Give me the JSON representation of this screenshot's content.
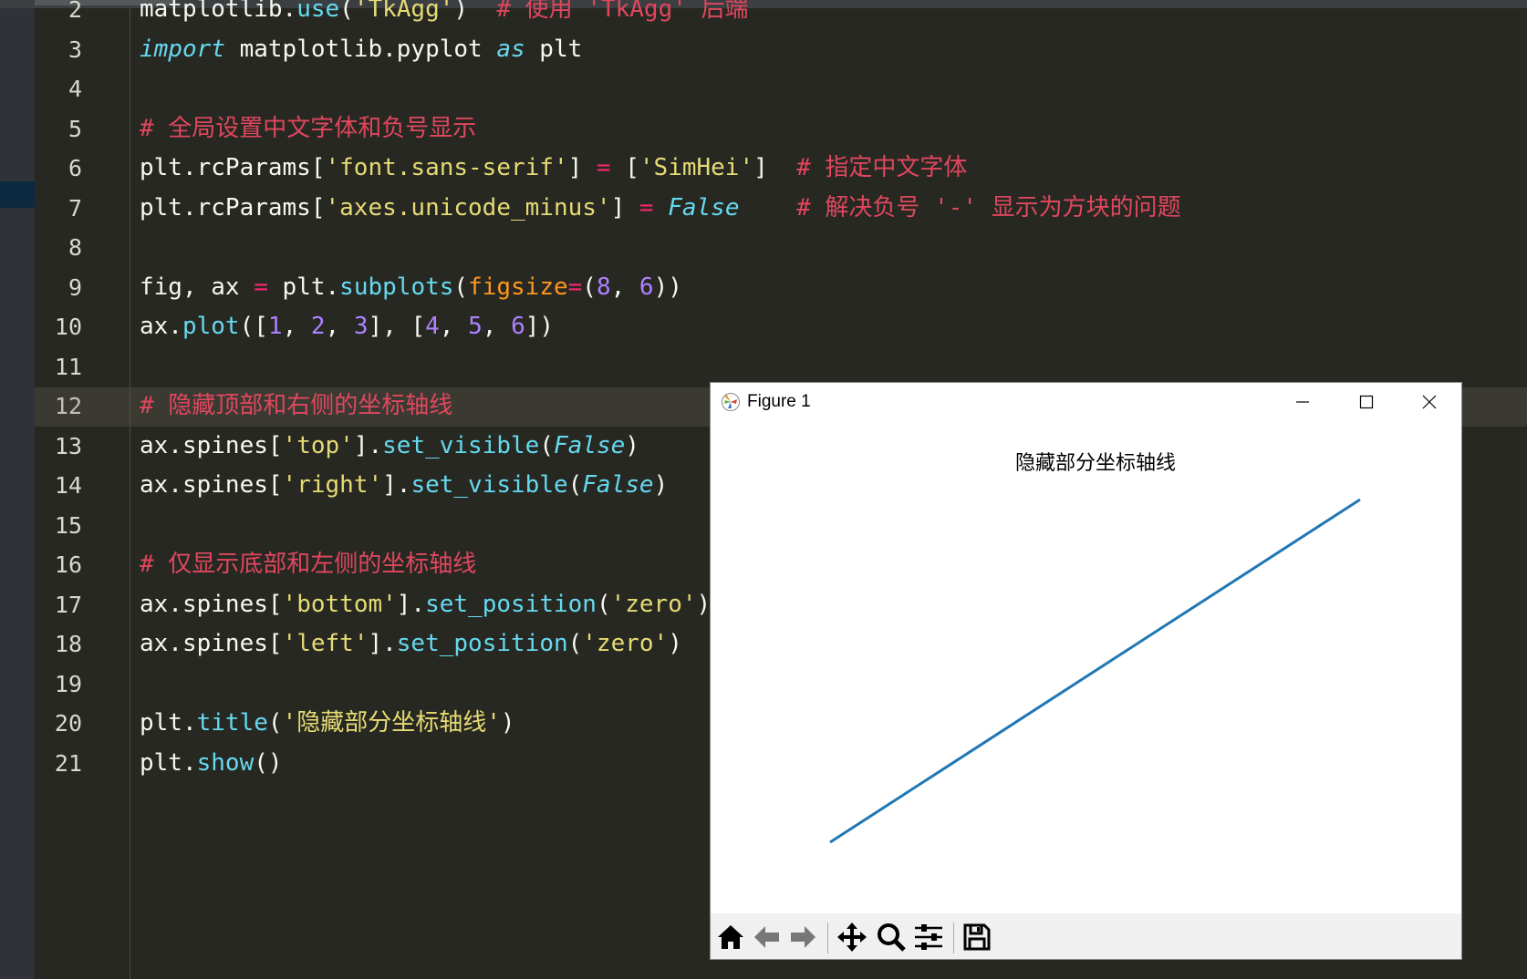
{
  "editor": {
    "current_line": 12,
    "lines": [
      {
        "n": "2",
        "tokens": [
          [
            "matplotlib.",
            ""
          ],
          [
            "use",
            "t-fn"
          ],
          [
            "(",
            ""
          ],
          [
            "'TkAgg'",
            "t-str"
          ],
          [
            ")  ",
            ""
          ],
          [
            "# 使用 'TkAgg' 后端",
            "t-cmt"
          ]
        ]
      },
      {
        "n": "3",
        "tokens": [
          [
            "import",
            "t-kw"
          ],
          [
            " matplotlib.pyplot ",
            ""
          ],
          [
            "as",
            "t-kw"
          ],
          [
            " plt",
            ""
          ]
        ]
      },
      {
        "n": "4",
        "tokens": []
      },
      {
        "n": "5",
        "tokens": [
          [
            "# 全局设置中文字体和负号显示",
            "t-cmt"
          ]
        ]
      },
      {
        "n": "6",
        "tokens": [
          [
            "plt.rcParams[",
            ""
          ],
          [
            "'font.sans-serif'",
            "t-str"
          ],
          [
            "] ",
            ""
          ],
          [
            "=",
            "t-op"
          ],
          [
            " [",
            ""
          ],
          [
            "'SimHei'",
            "t-str"
          ],
          [
            "]  ",
            ""
          ],
          [
            "# 指定中文字体",
            "t-cmt"
          ]
        ]
      },
      {
        "n": "7",
        "tokens": [
          [
            "plt.rcParams[",
            ""
          ],
          [
            "'axes.unicode_minus'",
            "t-str"
          ],
          [
            "] ",
            ""
          ],
          [
            "=",
            "t-op"
          ],
          [
            " ",
            ""
          ],
          [
            "False",
            "t-kw"
          ],
          [
            "    ",
            ""
          ],
          [
            "# 解决负号 '-' 显示为方块的问题",
            "t-cmt"
          ]
        ]
      },
      {
        "n": "8",
        "tokens": []
      },
      {
        "n": "9",
        "tokens": [
          [
            "fig, ax ",
            ""
          ],
          [
            "=",
            "t-op"
          ],
          [
            " plt.",
            ""
          ],
          [
            "subplots",
            "t-fn"
          ],
          [
            "(",
            ""
          ],
          [
            "figsize",
            "t-par"
          ],
          [
            "=",
            "t-op"
          ],
          [
            "(",
            ""
          ],
          [
            "8",
            "t-num"
          ],
          [
            ", ",
            ""
          ],
          [
            "6",
            "t-num"
          ],
          [
            "))",
            ""
          ]
        ]
      },
      {
        "n": "10",
        "tokens": [
          [
            "ax.",
            ""
          ],
          [
            "plot",
            "t-fn"
          ],
          [
            "([",
            ""
          ],
          [
            "1",
            "t-num"
          ],
          [
            ", ",
            ""
          ],
          [
            "2",
            "t-num"
          ],
          [
            ", ",
            ""
          ],
          [
            "3",
            "t-num"
          ],
          [
            "], [",
            ""
          ],
          [
            "4",
            "t-num"
          ],
          [
            ", ",
            ""
          ],
          [
            "5",
            "t-num"
          ],
          [
            ", ",
            ""
          ],
          [
            "6",
            "t-num"
          ],
          [
            "])",
            ""
          ]
        ]
      },
      {
        "n": "11",
        "tokens": []
      },
      {
        "n": "12",
        "tokens": [
          [
            "# 隐藏顶部和右侧的坐标轴线",
            "t-cmt"
          ]
        ]
      },
      {
        "n": "13",
        "tokens": [
          [
            "ax.spines[",
            ""
          ],
          [
            "'top'",
            "t-str"
          ],
          [
            "].",
            ""
          ],
          [
            "set_visible",
            "t-fn"
          ],
          [
            "(",
            ""
          ],
          [
            "False",
            "t-kw"
          ],
          [
            ")",
            ""
          ]
        ]
      },
      {
        "n": "14",
        "tokens": [
          [
            "ax.spines[",
            ""
          ],
          [
            "'right'",
            "t-str"
          ],
          [
            "].",
            ""
          ],
          [
            "set_visible",
            "t-fn"
          ],
          [
            "(",
            ""
          ],
          [
            "False",
            "t-kw"
          ],
          [
            ")",
            ""
          ]
        ]
      },
      {
        "n": "15",
        "tokens": []
      },
      {
        "n": "16",
        "tokens": [
          [
            "# 仅显示底部和左侧的坐标轴线",
            "t-cmt"
          ]
        ]
      },
      {
        "n": "17",
        "tokens": [
          [
            "ax.spines[",
            ""
          ],
          [
            "'bottom'",
            "t-str"
          ],
          [
            "].",
            ""
          ],
          [
            "set_position",
            "t-fn"
          ],
          [
            "(",
            ""
          ],
          [
            "'zero'",
            "t-str"
          ],
          [
            ")",
            ""
          ]
        ]
      },
      {
        "n": "18",
        "tokens": [
          [
            "ax.spines[",
            ""
          ],
          [
            "'left'",
            "t-str"
          ],
          [
            "].",
            ""
          ],
          [
            "set_position",
            "t-fn"
          ],
          [
            "(",
            ""
          ],
          [
            "'zero'",
            "t-str"
          ],
          [
            ")",
            ""
          ]
        ]
      },
      {
        "n": "19",
        "tokens": []
      },
      {
        "n": "20",
        "tokens": [
          [
            "plt.",
            ""
          ],
          [
            "title",
            "t-fn"
          ],
          [
            "(",
            ""
          ],
          [
            "'隐藏部分坐标轴线'",
            "t-str"
          ],
          [
            ")",
            ""
          ]
        ]
      },
      {
        "n": "21",
        "tokens": [
          [
            "plt.",
            ""
          ],
          [
            "show",
            "t-fn"
          ],
          [
            "()",
            ""
          ]
        ]
      }
    ]
  },
  "figure_window": {
    "title": "Figure 1",
    "controls": [
      "minimize-icon",
      "maximize-icon",
      "close-icon"
    ],
    "toolbar": [
      "home-icon",
      "back-arrow-icon",
      "forward-arrow-icon",
      "pan-icon",
      "zoom-icon",
      "configure-subplots-icon",
      "save-icon"
    ]
  },
  "chart_data": {
    "type": "line",
    "title": "隐藏部分坐标轴线",
    "x": [
      1,
      2,
      3
    ],
    "series": [
      {
        "values": [
          4,
          5,
          6
        ],
        "color": "#1f77b4"
      }
    ],
    "xlim": [
      1,
      3
    ],
    "ylim": [
      4,
      6
    ],
    "spines_visible": {
      "top": false,
      "right": false
    },
    "grid": false
  }
}
